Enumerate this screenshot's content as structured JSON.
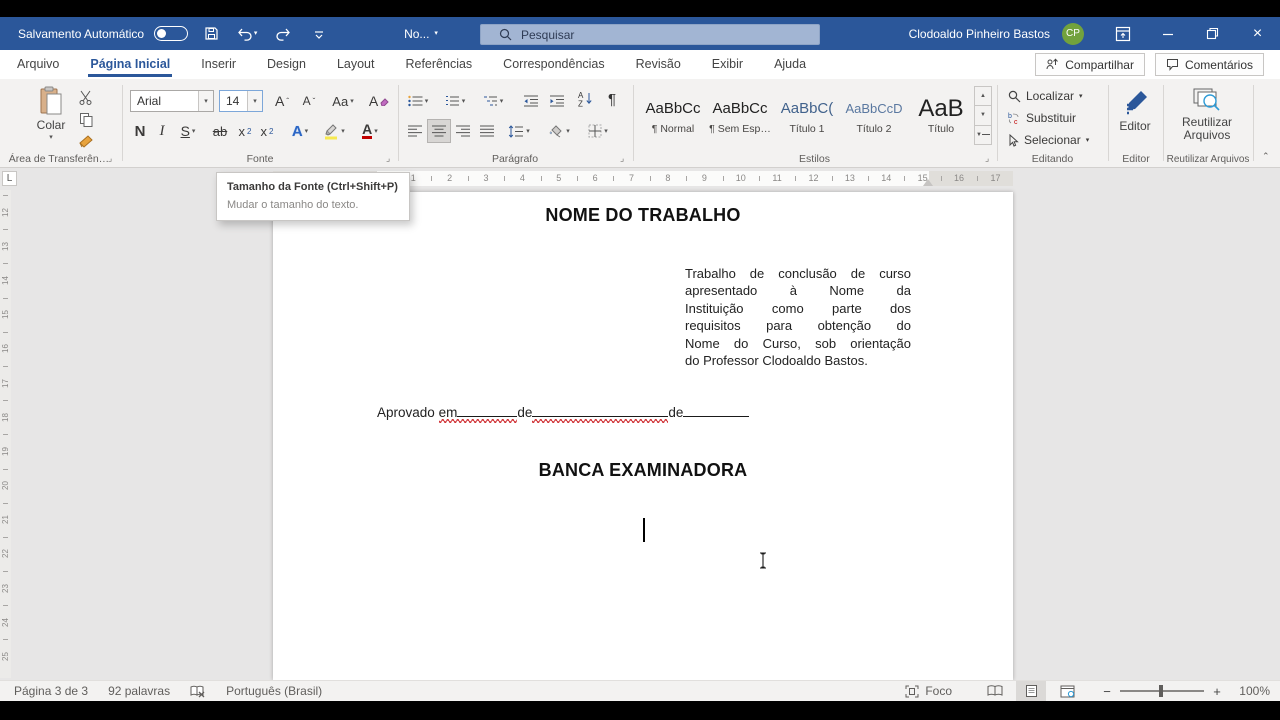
{
  "titlebar": {
    "autosave": "Salvamento Automático",
    "doc_name": "No...",
    "search_placeholder": "Pesquisar",
    "user_name": "Clodoaldo Pinheiro Bastos",
    "user_initials": "CP"
  },
  "tabs": [
    {
      "label": "Arquivo",
      "active": false
    },
    {
      "label": "Página Inicial",
      "active": true
    },
    {
      "label": "Inserir",
      "active": false
    },
    {
      "label": "Design",
      "active": false
    },
    {
      "label": "Layout",
      "active": false
    },
    {
      "label": "Referências",
      "active": false
    },
    {
      "label": "Correspondências",
      "active": false
    },
    {
      "label": "Revisão",
      "active": false
    },
    {
      "label": "Exibir",
      "active": false
    },
    {
      "label": "Ajuda",
      "active": false
    }
  ],
  "top_actions": {
    "share": "Compartilhar",
    "comments": "Comentários"
  },
  "ribbon": {
    "clipboard": {
      "paste": "Colar",
      "group": "Área de Transferên…"
    },
    "font": {
      "family": "Arial",
      "size": "14",
      "group": "Fonte",
      "bold": "N",
      "italic": "I",
      "underline": "S",
      "strike": "ab",
      "sub_base": "x",
      "sub_n": "2",
      "sup_base": "x",
      "sup_n": "2",
      "case_btn": "Aa",
      "grow": "A",
      "shrink": "A",
      "effects": "A",
      "color": "A",
      "clear": "A"
    },
    "paragraph": {
      "group": "Parágrafo"
    },
    "styles": {
      "group": "Estilos",
      "items": [
        {
          "preview": "AaBbCc",
          "name": "¶ Normal"
        },
        {
          "preview": "AaBbCc",
          "name": "¶ Sem Esp…"
        },
        {
          "preview": "AaBbC(",
          "name": "Título 1"
        },
        {
          "preview": "AaBbCcD",
          "name": "Título 2"
        },
        {
          "preview": "AaB",
          "name": "Título"
        }
      ]
    },
    "editing": {
      "find": "Localizar",
      "replace": "Substituir",
      "select": "Selecionar",
      "group": "Editando"
    },
    "editor": {
      "button": "Editor",
      "group": "Editor"
    },
    "reuse": {
      "line1": "Reutilizar",
      "line2": "Arquivos",
      "group": "Reutilizar Arquivos"
    }
  },
  "tooltip": {
    "title": "Tamanho da Fonte (Ctrl+Shift+P)",
    "desc": "Mudar o tamanho do texto."
  },
  "ruler": {
    "horizontal": [
      "1",
      "2",
      "3",
      "4",
      "5",
      "6",
      "7",
      "8",
      "9",
      "10",
      "11",
      "12",
      "13",
      "14",
      "15",
      "16",
      "17"
    ],
    "vertical": [
      "12",
      "13",
      "14",
      "15",
      "16",
      "17",
      "18",
      "19",
      "20",
      "21",
      "22",
      "23",
      "24",
      "25"
    ],
    "tab_selector": "L"
  },
  "document": {
    "title": "NOME DO TRABALHO",
    "paragraph_lines": [
      "Trabalho de conclusão de curso",
      "apresentado à Nome da",
      "Instituição como parte dos",
      "requisitos para obtenção do",
      "Nome do Curso, sob orientação",
      "do Professor Clodoaldo Bastos."
    ],
    "approval": {
      "prefix": "Aprovado",
      "word1": "em",
      "word2": "de",
      "word3": "de"
    },
    "banca": "BANCA EXAMINADORA"
  },
  "statusbar": {
    "page": "Página 3 de 3",
    "words": "92 palavras",
    "language": "Português (Brasil)",
    "focus": "Foco",
    "zoom_level": "100%"
  },
  "colors": {
    "accent": "#2b579a",
    "avatar": "#72a23d",
    "spellcheck": "#d13438",
    "font_color_bar": "#c00000",
    "highlight": "#f7e94f"
  }
}
